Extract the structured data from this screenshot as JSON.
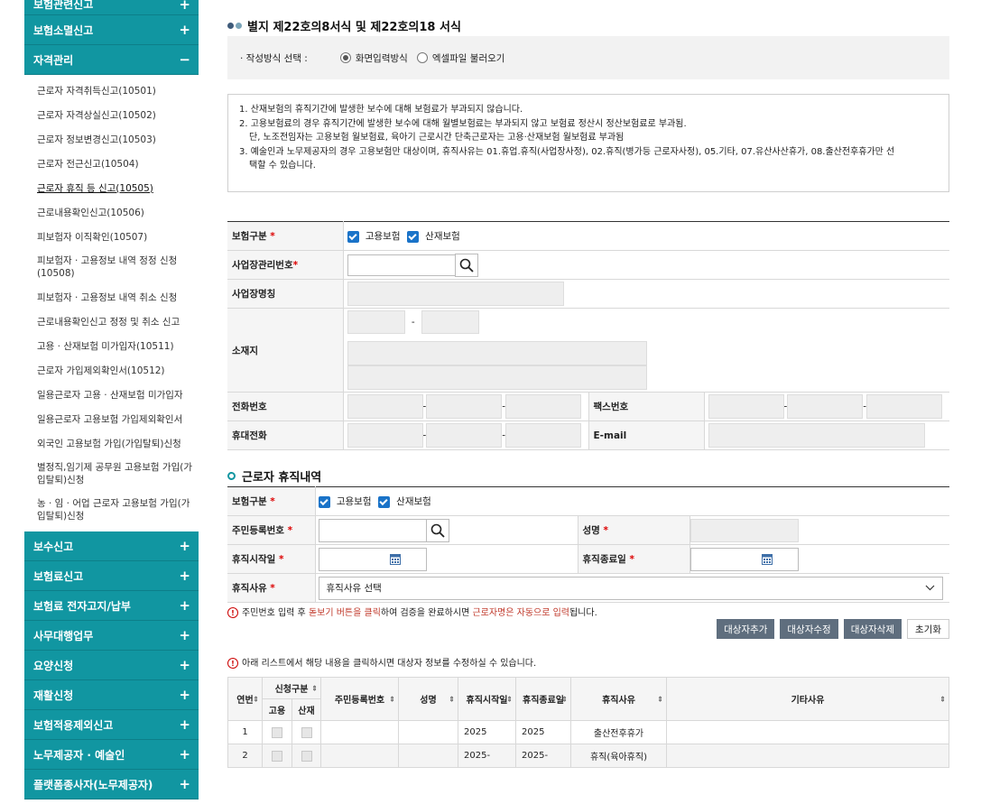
{
  "sidebar": {
    "top_cut": "보험관련신고",
    "sections_before": [
      {
        "label": "보험소멸신고",
        "sign": "+"
      }
    ],
    "active_section": {
      "label": "자격관리",
      "sign": "−"
    },
    "sub_items": [
      "근로자 자격취득신고(10501)",
      "근로자 자격상실신고(10502)",
      "근로자 정보변경신고(10503)",
      "근로자 전근신고(10504)",
      "근로자 휴직 등 신고(10505)",
      "근로내용확인신고(10506)",
      "피보험자 이직확인(10507)",
      "피보험자 · 고용정보 내역 정정 신청(10508)",
      "피보험자 · 고용정보 내역 취소 신청",
      "근로내용확인신고 정정 및 취소 신고",
      "고용 · 산재보험 미가입자(10511)",
      "근로자 가입제외확인서(10512)",
      "일용근로자 고용 · 산재보험 미가입자",
      "일용근로자 고용보험 가입제외확인서",
      "외국인 고용보험 가입(가입탈퇴)신청",
      "별정직,임기제 공무원 고용보험 가입(가입탈퇴)신청",
      "농 · 임 · 어업 근로자 고용보험 가입(가입탈퇴)신청"
    ],
    "active_sub_index": 4,
    "sections_after": [
      {
        "label": "보수신고",
        "sign": "+"
      },
      {
        "label": "보험료신고",
        "sign": "+"
      },
      {
        "label": "보험료 전자고지/납부",
        "sign": "+"
      },
      {
        "label": "사무대행업무",
        "sign": "+"
      },
      {
        "label": "요양신청",
        "sign": "+"
      },
      {
        "label": "재활신청",
        "sign": "+"
      },
      {
        "label": "보험적용제외신고",
        "sign": "+"
      },
      {
        "label": "노무제공자 · 예술인",
        "sign": "+"
      },
      {
        "label": "플랫폼종사자(노무제공자)",
        "sign": "+"
      }
    ]
  },
  "header": {
    "title": "별지 제22호의8서식 및 제22호의18 서식"
  },
  "method": {
    "label": "· 작성방식 선택 :",
    "option1": "화면입력방식",
    "option2": "엑셀파일 불러오기"
  },
  "notice": {
    "lines": [
      "1. 산재보험의 휴직기간에 발생한 보수에 대해 보험료가 부과되지 않습니다.",
      "2. 고용보험료의 경우 휴직기간에 발생한 보수에 대해 월별보험료는 부과되지 않고 보험료 정산시 정산보험료로 부과됨.",
      "단, 노조전임자는 고용보험 월보험료, 육아기 근로시간 단축근로자는 고용·산재보험 월보험료 부과됨",
      "3. 예술인과 노무제공자의 경우 고용보험만 대상이며, 휴직사유는 01.휴업.휴직(사업장사정), 02.휴직(병가등 근로자사정), 05.기타, 07.유산사산휴가, 08.출산전후휴가만 선",
      "택할 수 있습니다."
    ]
  },
  "form1": {
    "insurance_label": "보험구분",
    "employment": "고용보험",
    "industrial": "산재보험",
    "biz_no_label": "사업장관리번호",
    "biz_name_label": "사업장명칭",
    "address_label": "소재지",
    "phone_label": "전화번호",
    "fax_label": "팩스번호",
    "mobile_label": "휴대전화",
    "email_label": "E-mail",
    "dash": "-"
  },
  "section2": {
    "title": "근로자 휴직내역"
  },
  "form2": {
    "insurance_label": "보험구분",
    "employment": "고용보험",
    "industrial": "산재보험",
    "rrn_label": "주민등록번호",
    "name_label": "성명",
    "start_label": "휴직시작일",
    "end_label": "휴직종료일",
    "reason_label": "휴직사유",
    "reason_value": "휴직사유 선택"
  },
  "hint": {
    "part1": "주민번호 입력 후 ",
    "part2": "돋보기 버튼을 클릭",
    "part3": "하여 검증을 완료하시면 ",
    "part4": "근로자명은 자동으로 입력",
    "part5": "됩니다."
  },
  "buttons": {
    "add": "대상자추가",
    "edit": "대상자수정",
    "delete": "대상자삭제",
    "reset": "초기화"
  },
  "list_hint": "아래 리스트에서 해당 내용을 클릭하시면 대상자 정보를 수정하실 수 있습니다.",
  "table": {
    "headers": {
      "no": "연번",
      "type": "신청구분",
      "type_emp": "고용",
      "type_ind": "산재",
      "rrn": "주민등록번호",
      "name": "성명",
      "start": "휴직시작일",
      "end": "휴직종료일",
      "reason": "휴직사유",
      "etc": "기타사유"
    },
    "rows": [
      {
        "no": "1",
        "start": "2025",
        "end": "2025",
        "reason": "출산전후휴가"
      },
      {
        "no": "2",
        "start": "2025-",
        "end": "2025-",
        "reason": "휴직(육아휴직)"
      }
    ]
  }
}
